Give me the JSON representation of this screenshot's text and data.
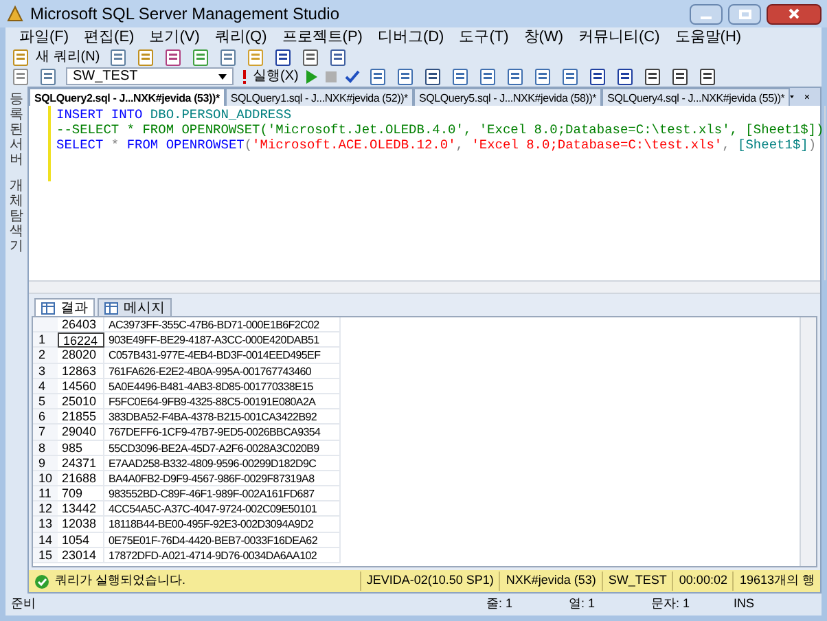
{
  "window": {
    "title": "Microsoft SQL Server Management Studio"
  },
  "menu": [
    "파일(F)",
    "편집(E)",
    "보기(V)",
    "쿼리(Q)",
    "프로젝트(P)",
    "디버그(D)",
    "도구(T)",
    "창(W)",
    "커뮤니티(C)",
    "도움말(H)"
  ],
  "toolbar": {
    "new_query": "새 쿼리(N)",
    "database": "SW_TEST",
    "execute": "실행(X)"
  },
  "side_tabs": [
    "등록된 서버",
    "개체 탐색기"
  ],
  "tabs": [
    {
      "label": "SQLQuery2.sql - J...NXK#jevida (53))*",
      "selected": true
    },
    {
      "label": "SQLQuery1.sql - J...NXK#jevida (52))*",
      "selected": false
    },
    {
      "label": "SQLQuery5.sql - J...NXK#jevida (58))*",
      "selected": false
    },
    {
      "label": "SQLQuery4.sql - J...NXK#jevida (55))*",
      "selected": false
    }
  ],
  "editor": {
    "lines": [
      [
        {
          "kind": "keyword",
          "text": "INSERT INTO "
        },
        {
          "kind": "identifier",
          "text": "DBO.PERSON_ADDRESS"
        }
      ],
      [
        {
          "kind": "comment",
          "text": "--SELECT * FROM OPENROWSET('Microsoft.Jet.OLEDB.4.0', 'Excel 8.0;Database=C:\\test.xls', [Sheet1$])"
        }
      ],
      [
        {
          "kind": "keyword",
          "text": "SELECT "
        },
        {
          "kind": "plain",
          "text": "* "
        },
        {
          "kind": "keyword",
          "text": "FROM OPENROWSET"
        },
        {
          "kind": "plain",
          "text": "("
        },
        {
          "kind": "string",
          "text": "'Microsoft.ACE.OLEDB.12.0'"
        },
        {
          "kind": "plain",
          "text": ", "
        },
        {
          "kind": "string",
          "text": "'Excel 8.0;Database=C:\\test.xls'"
        },
        {
          "kind": "plain",
          "text": ", "
        },
        {
          "kind": "identifier",
          "text": "[Sheet1$]"
        },
        {
          "kind": "plain",
          "text": ")"
        }
      ]
    ]
  },
  "result_tabs": [
    {
      "label": "결과",
      "selected": true
    },
    {
      "label": "메시지",
      "selected": false
    }
  ],
  "grid": {
    "rows": [
      {
        "number": "",
        "id": "26403",
        "guid": "AC3973FF-355C-47B6-BD71-000E1B6F2C02",
        "focused": false
      },
      {
        "number": "1",
        "id": "16224",
        "guid": "903E49FF-BE29-4187-A3CC-000E420DAB51",
        "focused": true
      },
      {
        "number": "2",
        "id": "28020",
        "guid": "C057B431-977E-4EB4-BD3F-0014EED495EF",
        "focused": false
      },
      {
        "number": "3",
        "id": "12863",
        "guid": "761FA626-E2E2-4B0A-995A-001767743460",
        "focused": false
      },
      {
        "number": "4",
        "id": "14560",
        "guid": "5A0E4496-B481-4AB3-8D85-001770338E15",
        "focused": false
      },
      {
        "number": "5",
        "id": "25010",
        "guid": "F5FC0E64-9FB9-4325-88C5-00191E080A2A",
        "focused": false
      },
      {
        "number": "6",
        "id": "21855",
        "guid": "383DBA52-F4BA-4378-B215-001CA3422B92",
        "focused": false
      },
      {
        "number": "7",
        "id": "29040",
        "guid": "767DEFF6-1CF9-47B7-9ED5-0026BBCA9354",
        "focused": false
      },
      {
        "number": "8",
        "id": "985",
        "guid": "55CD3096-BE2A-45D7-A2F6-0028A3C020B9",
        "focused": false
      },
      {
        "number": "9",
        "id": "24371",
        "guid": "E7AAD258-B332-4809-9596-00299D182D9C",
        "focused": false
      },
      {
        "number": "10",
        "id": "21688",
        "guid": "BA4A0FB2-D9F9-4567-986F-0029F87319A8",
        "focused": false
      },
      {
        "number": "11",
        "id": "709",
        "guid": "983552BD-C89F-46F1-989F-002A161FD687",
        "focused": false
      },
      {
        "number": "12",
        "id": "13442",
        "guid": "4CC54A5C-A37C-4047-9724-002C09E50101",
        "focused": false
      },
      {
        "number": "13",
        "id": "12038",
        "guid": "18118B44-BE00-495F-92E3-002D3094A9D2",
        "focused": false
      },
      {
        "number": "14",
        "id": "1054",
        "guid": "0E75E01F-76D4-4420-BEB7-0033F16DEA62",
        "focused": false
      },
      {
        "number": "15",
        "id": "23014",
        "guid": "17872DFD-A021-4714-9D76-0034DA6AA102",
        "focused": false
      }
    ]
  },
  "query_status": {
    "message": "쿼리가 실행되었습니다.",
    "segments": [
      "JEVIDA-02(10.50 SP1)",
      "NXK#jevida (53)",
      "SW_TEST",
      "00:00:02",
      "19613개의 행"
    ]
  },
  "status_bar": {
    "ready": "준비",
    "items": [
      "줄: 1",
      "열: 1",
      "문자: 1",
      "INS"
    ]
  }
}
